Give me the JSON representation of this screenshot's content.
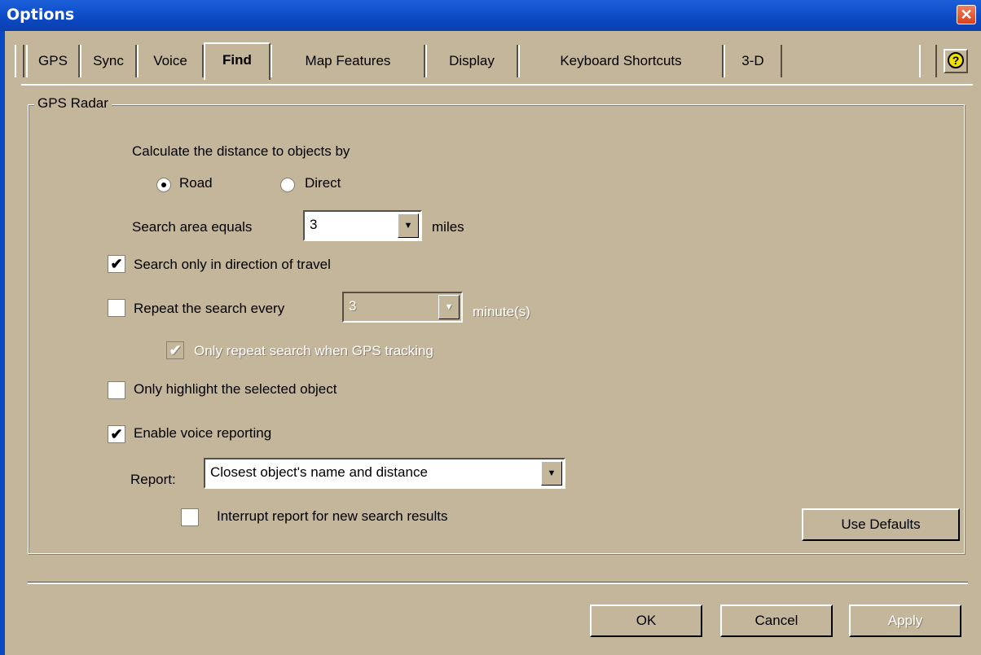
{
  "window": {
    "title": "Options",
    "close_glyph": "✕"
  },
  "tabs": [
    {
      "label": "GPS"
    },
    {
      "label": "Sync"
    },
    {
      "label": "Voice"
    },
    {
      "label": "Find",
      "active": true
    },
    {
      "label": "Map Features"
    },
    {
      "label": "Display"
    },
    {
      "label": "Keyboard Shortcuts"
    },
    {
      "label": "3-D"
    }
  ],
  "help": {
    "glyph": "?"
  },
  "group": {
    "label": "GPS Radar"
  },
  "distance": {
    "label": "Calculate the distance to objects by",
    "road": "Road",
    "direct": "Direct",
    "selected": "Road"
  },
  "search_area": {
    "label": "Search area equals",
    "value": "3",
    "unit": "miles"
  },
  "direction_travel": {
    "label": "Search only in direction of travel",
    "checked": true
  },
  "repeat": {
    "label": "Repeat the search every",
    "value": "3",
    "unit": "minute(s)",
    "checked": false
  },
  "only_repeat": {
    "label": "Only repeat search when GPS tracking",
    "checked": true,
    "disabled": true
  },
  "highlight": {
    "label": "Only highlight the selected object",
    "checked": false
  },
  "voice": {
    "label": "Enable voice reporting",
    "checked": true
  },
  "report": {
    "label": "Report:",
    "value": "Closest object's name and distance"
  },
  "interrupt": {
    "label": "Interrupt report for new search results",
    "checked": false
  },
  "buttons": {
    "use_defaults": "Use Defaults",
    "ok": "OK",
    "cancel": "Cancel",
    "apply": "Apply"
  },
  "glyphs": {
    "check": "✔",
    "arrow": "▼"
  }
}
